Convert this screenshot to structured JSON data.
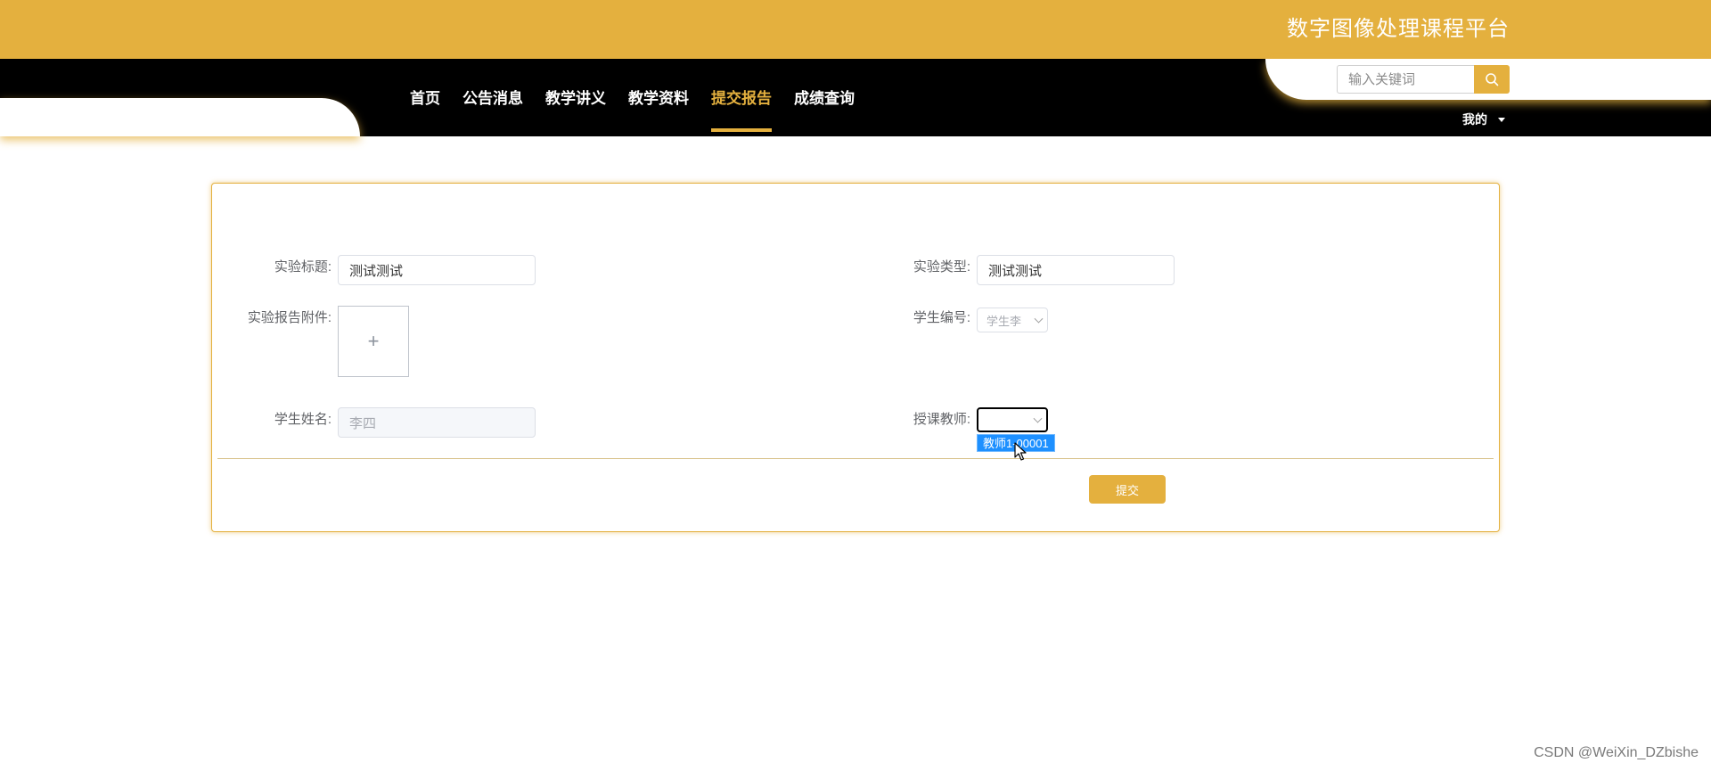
{
  "header": {
    "site_title": "数字图像处理课程平台",
    "search": {
      "placeholder": "输入关键词",
      "value": "",
      "icon": "search-icon"
    },
    "nav": [
      {
        "label": "首页",
        "active": false
      },
      {
        "label": "公告消息",
        "active": false
      },
      {
        "label": "教学讲义",
        "active": false
      },
      {
        "label": "教学资料",
        "active": false
      },
      {
        "label": "提交报告",
        "active": true
      },
      {
        "label": "成绩查询",
        "active": false
      }
    ],
    "user_menu": {
      "label": "我的",
      "icon": "caret-down-icon"
    }
  },
  "form": {
    "title_label": "实验标题:",
    "title_value": "测试测试",
    "type_label": "实验类型:",
    "type_value": "测试测试",
    "attachment_label": "实验报告附件:",
    "attachment_plus": "+",
    "student_id_label": "学生编号:",
    "student_id_value": "学生李",
    "student_name_label": "学生姓名:",
    "student_name_value": "李四",
    "teacher_label": "授课教师:",
    "teacher_value": "",
    "teacher_options": [
      "教师1-00001"
    ],
    "submit_label": "提交"
  },
  "watermark": "CSDN @WeiXin_DZbishe",
  "colors": {
    "accent": "#e4b03e",
    "nav_bg": "#000000",
    "option_highlight": "#1e90ff"
  }
}
